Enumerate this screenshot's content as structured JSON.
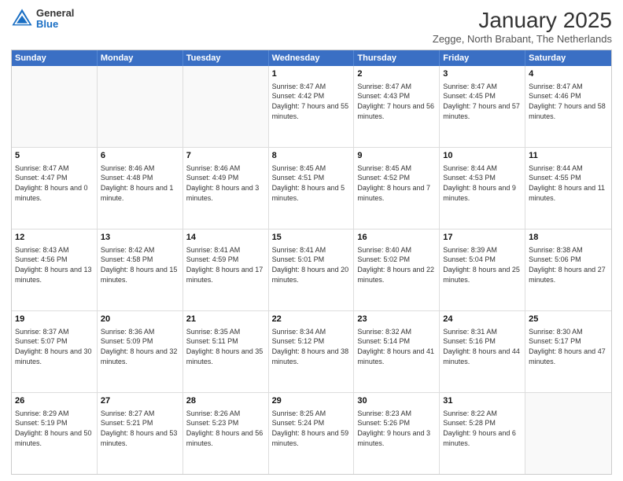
{
  "logo": {
    "general": "General",
    "blue": "Blue"
  },
  "title": "January 2025",
  "location": "Zegge, North Brabant, The Netherlands",
  "header_days": [
    "Sunday",
    "Monday",
    "Tuesday",
    "Wednesday",
    "Thursday",
    "Friday",
    "Saturday"
  ],
  "weeks": [
    [
      {
        "day": "",
        "sunrise": "",
        "sunset": "",
        "daylight": ""
      },
      {
        "day": "",
        "sunrise": "",
        "sunset": "",
        "daylight": ""
      },
      {
        "day": "",
        "sunrise": "",
        "sunset": "",
        "daylight": ""
      },
      {
        "day": "1",
        "sunrise": "Sunrise: 8:47 AM",
        "sunset": "Sunset: 4:42 PM",
        "daylight": "Daylight: 7 hours and 55 minutes."
      },
      {
        "day": "2",
        "sunrise": "Sunrise: 8:47 AM",
        "sunset": "Sunset: 4:43 PM",
        "daylight": "Daylight: 7 hours and 56 minutes."
      },
      {
        "day": "3",
        "sunrise": "Sunrise: 8:47 AM",
        "sunset": "Sunset: 4:45 PM",
        "daylight": "Daylight: 7 hours and 57 minutes."
      },
      {
        "day": "4",
        "sunrise": "Sunrise: 8:47 AM",
        "sunset": "Sunset: 4:46 PM",
        "daylight": "Daylight: 7 hours and 58 minutes."
      }
    ],
    [
      {
        "day": "5",
        "sunrise": "Sunrise: 8:47 AM",
        "sunset": "Sunset: 4:47 PM",
        "daylight": "Daylight: 8 hours and 0 minutes."
      },
      {
        "day": "6",
        "sunrise": "Sunrise: 8:46 AM",
        "sunset": "Sunset: 4:48 PM",
        "daylight": "Daylight: 8 hours and 1 minute."
      },
      {
        "day": "7",
        "sunrise": "Sunrise: 8:46 AM",
        "sunset": "Sunset: 4:49 PM",
        "daylight": "Daylight: 8 hours and 3 minutes."
      },
      {
        "day": "8",
        "sunrise": "Sunrise: 8:45 AM",
        "sunset": "Sunset: 4:51 PM",
        "daylight": "Daylight: 8 hours and 5 minutes."
      },
      {
        "day": "9",
        "sunrise": "Sunrise: 8:45 AM",
        "sunset": "Sunset: 4:52 PM",
        "daylight": "Daylight: 8 hours and 7 minutes."
      },
      {
        "day": "10",
        "sunrise": "Sunrise: 8:44 AM",
        "sunset": "Sunset: 4:53 PM",
        "daylight": "Daylight: 8 hours and 9 minutes."
      },
      {
        "day": "11",
        "sunrise": "Sunrise: 8:44 AM",
        "sunset": "Sunset: 4:55 PM",
        "daylight": "Daylight: 8 hours and 11 minutes."
      }
    ],
    [
      {
        "day": "12",
        "sunrise": "Sunrise: 8:43 AM",
        "sunset": "Sunset: 4:56 PM",
        "daylight": "Daylight: 8 hours and 13 minutes."
      },
      {
        "day": "13",
        "sunrise": "Sunrise: 8:42 AM",
        "sunset": "Sunset: 4:58 PM",
        "daylight": "Daylight: 8 hours and 15 minutes."
      },
      {
        "day": "14",
        "sunrise": "Sunrise: 8:41 AM",
        "sunset": "Sunset: 4:59 PM",
        "daylight": "Daylight: 8 hours and 17 minutes."
      },
      {
        "day": "15",
        "sunrise": "Sunrise: 8:41 AM",
        "sunset": "Sunset: 5:01 PM",
        "daylight": "Daylight: 8 hours and 20 minutes."
      },
      {
        "day": "16",
        "sunrise": "Sunrise: 8:40 AM",
        "sunset": "Sunset: 5:02 PM",
        "daylight": "Daylight: 8 hours and 22 minutes."
      },
      {
        "day": "17",
        "sunrise": "Sunrise: 8:39 AM",
        "sunset": "Sunset: 5:04 PM",
        "daylight": "Daylight: 8 hours and 25 minutes."
      },
      {
        "day": "18",
        "sunrise": "Sunrise: 8:38 AM",
        "sunset": "Sunset: 5:06 PM",
        "daylight": "Daylight: 8 hours and 27 minutes."
      }
    ],
    [
      {
        "day": "19",
        "sunrise": "Sunrise: 8:37 AM",
        "sunset": "Sunset: 5:07 PM",
        "daylight": "Daylight: 8 hours and 30 minutes."
      },
      {
        "day": "20",
        "sunrise": "Sunrise: 8:36 AM",
        "sunset": "Sunset: 5:09 PM",
        "daylight": "Daylight: 8 hours and 32 minutes."
      },
      {
        "day": "21",
        "sunrise": "Sunrise: 8:35 AM",
        "sunset": "Sunset: 5:11 PM",
        "daylight": "Daylight: 8 hours and 35 minutes."
      },
      {
        "day": "22",
        "sunrise": "Sunrise: 8:34 AM",
        "sunset": "Sunset: 5:12 PM",
        "daylight": "Daylight: 8 hours and 38 minutes."
      },
      {
        "day": "23",
        "sunrise": "Sunrise: 8:32 AM",
        "sunset": "Sunset: 5:14 PM",
        "daylight": "Daylight: 8 hours and 41 minutes."
      },
      {
        "day": "24",
        "sunrise": "Sunrise: 8:31 AM",
        "sunset": "Sunset: 5:16 PM",
        "daylight": "Daylight: 8 hours and 44 minutes."
      },
      {
        "day": "25",
        "sunrise": "Sunrise: 8:30 AM",
        "sunset": "Sunset: 5:17 PM",
        "daylight": "Daylight: 8 hours and 47 minutes."
      }
    ],
    [
      {
        "day": "26",
        "sunrise": "Sunrise: 8:29 AM",
        "sunset": "Sunset: 5:19 PM",
        "daylight": "Daylight: 8 hours and 50 minutes."
      },
      {
        "day": "27",
        "sunrise": "Sunrise: 8:27 AM",
        "sunset": "Sunset: 5:21 PM",
        "daylight": "Daylight: 8 hours and 53 minutes."
      },
      {
        "day": "28",
        "sunrise": "Sunrise: 8:26 AM",
        "sunset": "Sunset: 5:23 PM",
        "daylight": "Daylight: 8 hours and 56 minutes."
      },
      {
        "day": "29",
        "sunrise": "Sunrise: 8:25 AM",
        "sunset": "Sunset: 5:24 PM",
        "daylight": "Daylight: 8 hours and 59 minutes."
      },
      {
        "day": "30",
        "sunrise": "Sunrise: 8:23 AM",
        "sunset": "Sunset: 5:26 PM",
        "daylight": "Daylight: 9 hours and 3 minutes."
      },
      {
        "day": "31",
        "sunrise": "Sunrise: 8:22 AM",
        "sunset": "Sunset: 5:28 PM",
        "daylight": "Daylight: 9 hours and 6 minutes."
      },
      {
        "day": "",
        "sunrise": "",
        "sunset": "",
        "daylight": ""
      }
    ]
  ]
}
